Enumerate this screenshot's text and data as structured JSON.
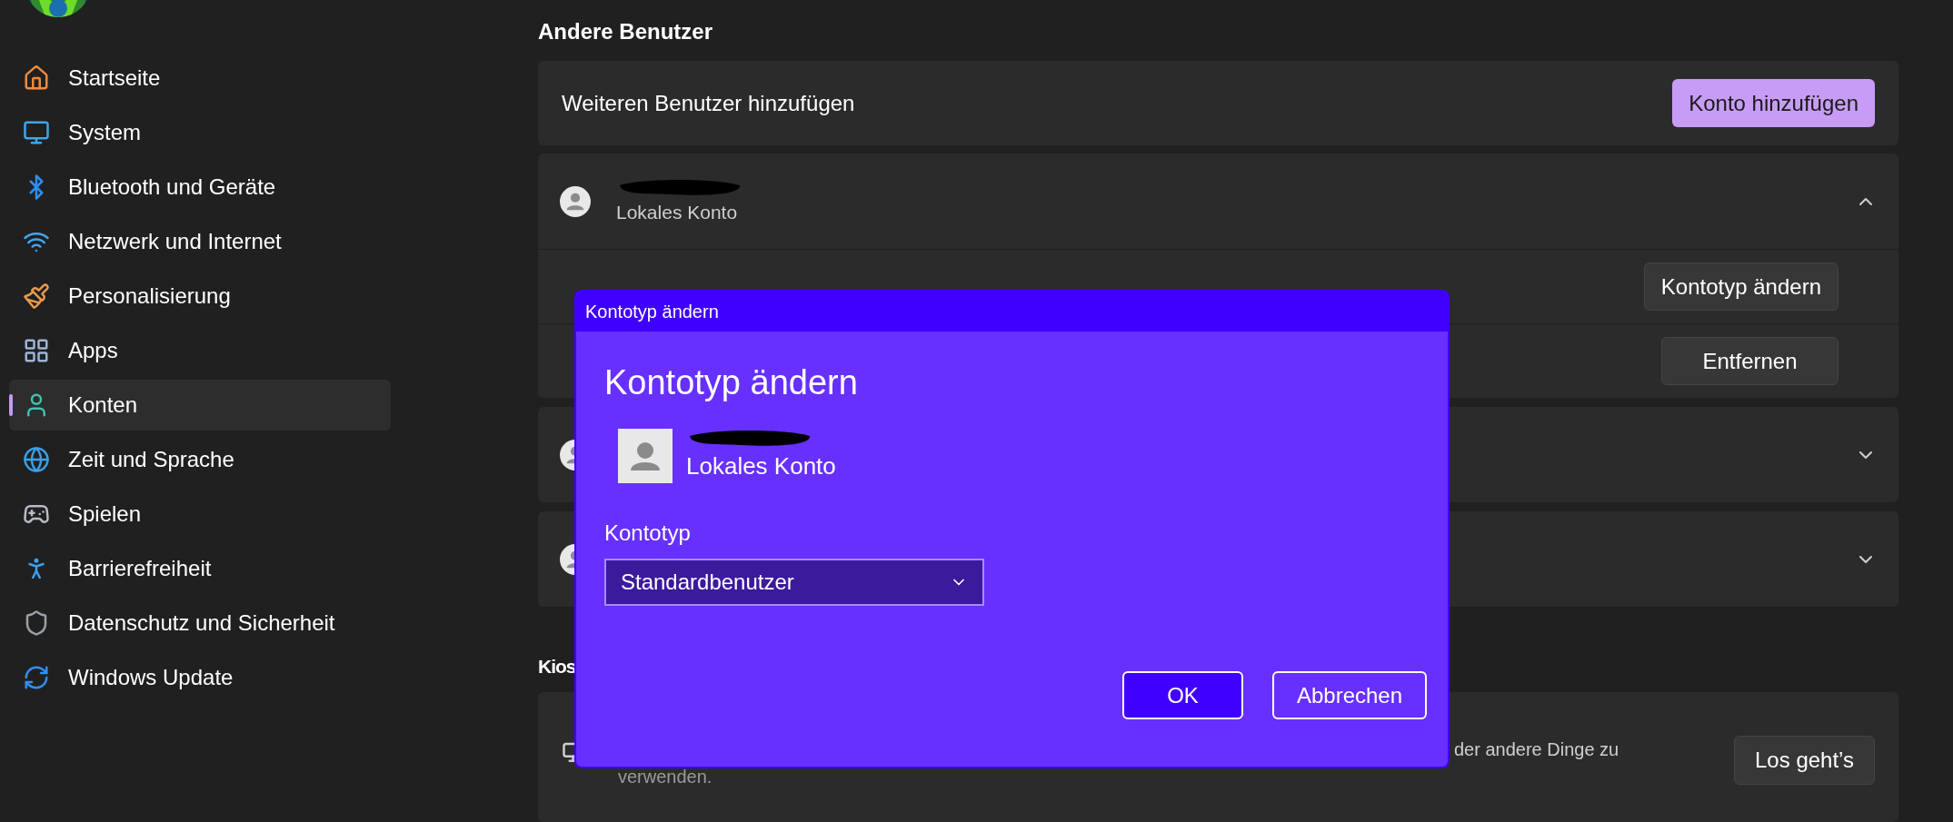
{
  "sidebar": {
    "items": [
      {
        "label": "Startseite",
        "selected": false
      },
      {
        "label": "System",
        "selected": false
      },
      {
        "label": "Bluetooth und Geräte",
        "selected": false
      },
      {
        "label": "Netzwerk und Internet",
        "selected": false
      },
      {
        "label": "Personalisierung",
        "selected": false
      },
      {
        "label": "Apps",
        "selected": false
      },
      {
        "label": "Konten",
        "selected": true
      },
      {
        "label": "Zeit und Sprache",
        "selected": false
      },
      {
        "label": "Spielen",
        "selected": false
      },
      {
        "label": "Barrierefreiheit",
        "selected": false
      },
      {
        "label": "Datenschutz und Sicherheit",
        "selected": false
      },
      {
        "label": "Windows Update",
        "selected": false
      }
    ]
  },
  "section_title": "Andere Benutzer",
  "add_user": {
    "label": "Weiteren Benutzer hinzufügen",
    "button": "Konto hinzufügen"
  },
  "users": [
    {
      "account_type": "Lokales Konto",
      "expanded": true,
      "options": [
        {
          "button": "Kontotyp ändern"
        },
        {
          "button": "Entfernen"
        }
      ]
    },
    {
      "expanded": false
    },
    {
      "expanded": false
    }
  ],
  "kiosk": {
    "title": "Kios",
    "description_lines": [
      "der andere Dinge zu",
      "verwenden."
    ],
    "button": "Los geht’s"
  },
  "dialog": {
    "title": "Kontotyp ändern",
    "heading": "Kontotyp ändern",
    "account_type": "Lokales Konto",
    "field_label": "Kontotyp",
    "select": {
      "value": "Standardbenutzer"
    },
    "buttons": [
      {
        "label": "OK",
        "kind": "primary"
      },
      {
        "label": "Abbrechen",
        "kind": "secondary"
      }
    ]
  }
}
